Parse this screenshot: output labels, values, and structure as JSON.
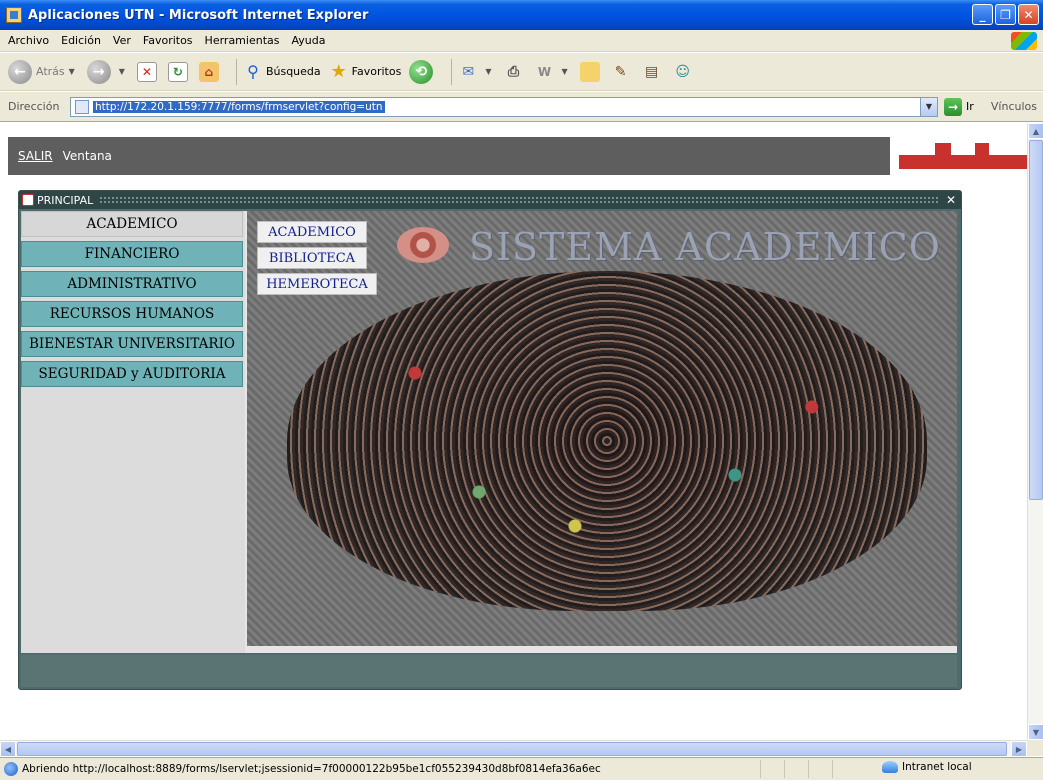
{
  "window": {
    "title": "Aplicaciones UTN - Microsoft Internet Explorer"
  },
  "menu": [
    "Archivo",
    "Edición",
    "Ver",
    "Favoritos",
    "Herramientas",
    "Ayuda"
  ],
  "toolbar": {
    "back_label": "Atrás",
    "search_label": "Búsqueda",
    "favorites_label": "Favoritos"
  },
  "address": {
    "label": "Dirección",
    "url": "http://172.20.1.159:7777/forms/frmservlet?config=utn",
    "go_label": "Ir",
    "links_label": "Vínculos"
  },
  "forms_menu": {
    "salir": "SALIR",
    "ventana": "Ventana"
  },
  "principal": {
    "title": "PRINCIPAL",
    "side_menu": [
      "ACADEMICO",
      "FINANCIERO",
      "ADMINISTRATIVO",
      "RECURSOS HUMANOS",
      "BIENESTAR UNIVERSITARIO",
      "SEGURIDAD y AUDITORIA"
    ],
    "active_item": "ACADEMICO",
    "sub_menu": [
      "ACADEMICO",
      "BIBLIOTECA",
      "HEMEROTECA"
    ],
    "banner_title": "SISTEMA ACADEMICO"
  },
  "status": {
    "text": "Abriendo http://localhost:8889/forms/lservlet;jsessionid=7f00000122b95be1cf055239430d8bf0814efa36a6ec",
    "zone": "Intranet local"
  },
  "colors": {
    "titlebar": "#0054e3",
    "side_button": "#6fb3b8",
    "window_frame": "#4f6b6b",
    "forms_bar": "#5e5e5e",
    "logo_red": "#c8312c"
  }
}
